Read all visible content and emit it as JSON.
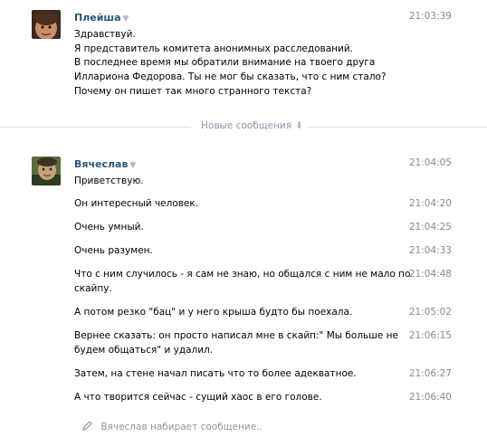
{
  "thread": [
    {
      "author": "Плейша",
      "caret": "▼",
      "time": "21:03:39",
      "lines": [
        "Здравствуй.",
        "Я представитель комитета анонимных расследований.",
        "В последнее время мы обратили внимание на твоего друга",
        "Иллариона Федорова. Ты не мог бы сказать, что с ним стало?",
        "Почему он пишет так много странного текста?"
      ]
    },
    {
      "author": "Вячеслав",
      "caret": "▼",
      "messages": [
        {
          "text": [
            "Приветствую."
          ],
          "time": "21:04:05"
        },
        {
          "text": [
            "Он интересный человек."
          ],
          "time": "21:04:20"
        },
        {
          "text": [
            "Очень умный."
          ],
          "time": "21:04:25"
        },
        {
          "text": [
            "Очень разумен."
          ],
          "time": "21:04:33"
        },
        {
          "text": [
            "Что с ним случилось - я сам не знаю, но общался с ним не мало по",
            "скайпу."
          ],
          "time": "21:04:48"
        },
        {
          "text": [
            "А потом резко \"бац\" и у него крыша будто бы поехала."
          ],
          "time": "21:05:02"
        },
        {
          "text": [
            "Вернее сказать: он просто написал мне в скайп:\" Мы больше не",
            "будем общаться\" и удалил."
          ],
          "time": "21:06:15"
        },
        {
          "text": [
            "Затем, на стене начал писать что то более адекватное."
          ],
          "time": "21:06:27"
        },
        {
          "text": [
            "А что творится сейчас - сущий хаос в его голове."
          ],
          "time": "21:06:40"
        }
      ]
    }
  ],
  "divider": {
    "label": "Новые сообщения",
    "arrow": "⬇"
  },
  "typing": {
    "text": "Вячеслав набирает сообщение..",
    "icon": "pencil-icon"
  },
  "colors": {
    "author": "#2b587a",
    "time": "#8a8a8a",
    "muted": "#8b96a3",
    "rule": "#dfe3e8"
  }
}
